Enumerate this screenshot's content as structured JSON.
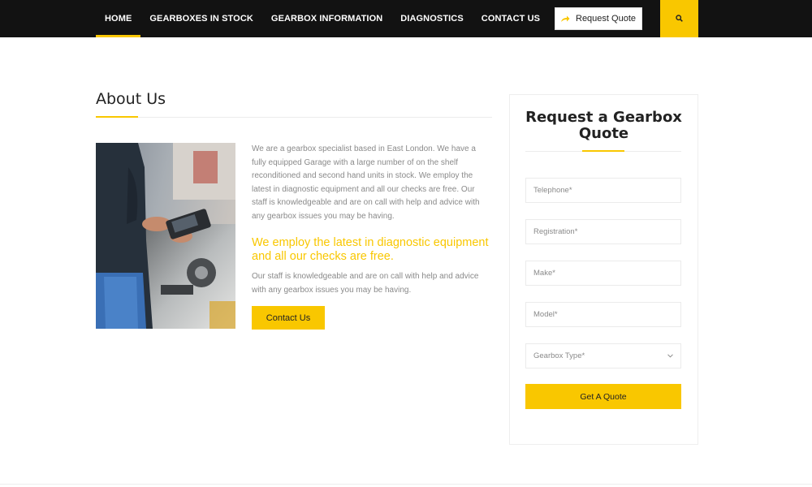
{
  "nav": {
    "items": [
      {
        "label": "HOME",
        "active": true
      },
      {
        "label": "GEARBOXES IN STOCK",
        "active": false
      },
      {
        "label": "GEARBOX INFORMATION",
        "active": false
      },
      {
        "label": "DIAGNOSTICS",
        "active": false
      },
      {
        "label": "CONTACT US",
        "active": false
      }
    ],
    "quote_label": "Request Quote",
    "quote_icon": "share-arrow-icon",
    "search_icon": "search-icon"
  },
  "about": {
    "title": "About Us",
    "paragraph": "We are a gearbox specialist based in East London. We have a fully equipped Garage with a large number of on the shelf reconditioned and second hand units in stock. We employ the latest in diagnostic equipment and all our checks are free. Our staff is knowledgeable and are on call with help and advice with any gearbox issues you may be having.",
    "highlight": "We employ the latest in diagnostic equipment and all our checks are free.",
    "paragraph2": "Our staff is knowledgeable and are on call with help and advice with any gearbox issues you may be having.",
    "button_label": "Contact Us"
  },
  "form": {
    "title": "Request a Gearbox Quote",
    "telephone_placeholder": "Telephone*",
    "registration_placeholder": "Registration*",
    "make_placeholder": "Make*",
    "model_placeholder": "Model*",
    "gearbox_type_placeholder": "Gearbox Type*",
    "submit_label": "Get A Quote"
  },
  "colors": {
    "accent": "#f9c700",
    "nav_bg": "#121212",
    "body_text": "#8a8a8a"
  }
}
